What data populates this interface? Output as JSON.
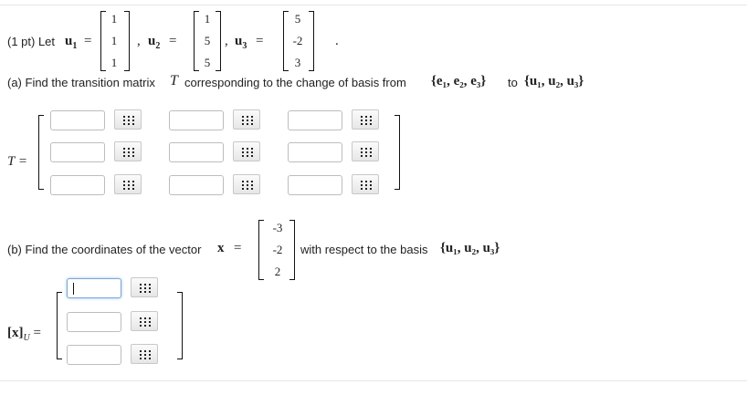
{
  "problem": {
    "header": "(1 pt) Let",
    "u1_sym": "u",
    "u1_sub": "1",
    "u2_sym": "u",
    "u2_sub": "2",
    "u3_sym": "u",
    "u3_sub": "3",
    "eq": "=",
    "comma": ",",
    "period": ".",
    "u1": [
      "1",
      "1",
      "1"
    ],
    "u2": [
      "1",
      "5",
      "5"
    ],
    "u3": [
      "5",
      "-2",
      "3"
    ]
  },
  "part_a": {
    "text": "(a) Find the transition matrix",
    "T": "T",
    "text2": "corresponding to the change of basis from",
    "basis_e": "{e₁, e₂, e₃}",
    "to": "to",
    "basis_u": "{u₁, u₂, u₃}",
    "matrix_label": "T =",
    "inputs": [
      [
        "",
        "",
        ""
      ],
      [
        "",
        "",
        ""
      ],
      [
        "",
        "",
        ""
      ]
    ]
  },
  "part_b": {
    "text": "(b) Find the coordinates of the vector",
    "x": "x",
    "eq": "=",
    "x_vec": [
      "-3",
      "-2",
      "2"
    ],
    "text2": "with respect to the basis",
    "basis_u": "{u₁, u₂, u₃}",
    "label_x": "[x]",
    "label_sub": "U",
    "label_eq": "=",
    "inputs": [
      "",
      "",
      ""
    ]
  }
}
